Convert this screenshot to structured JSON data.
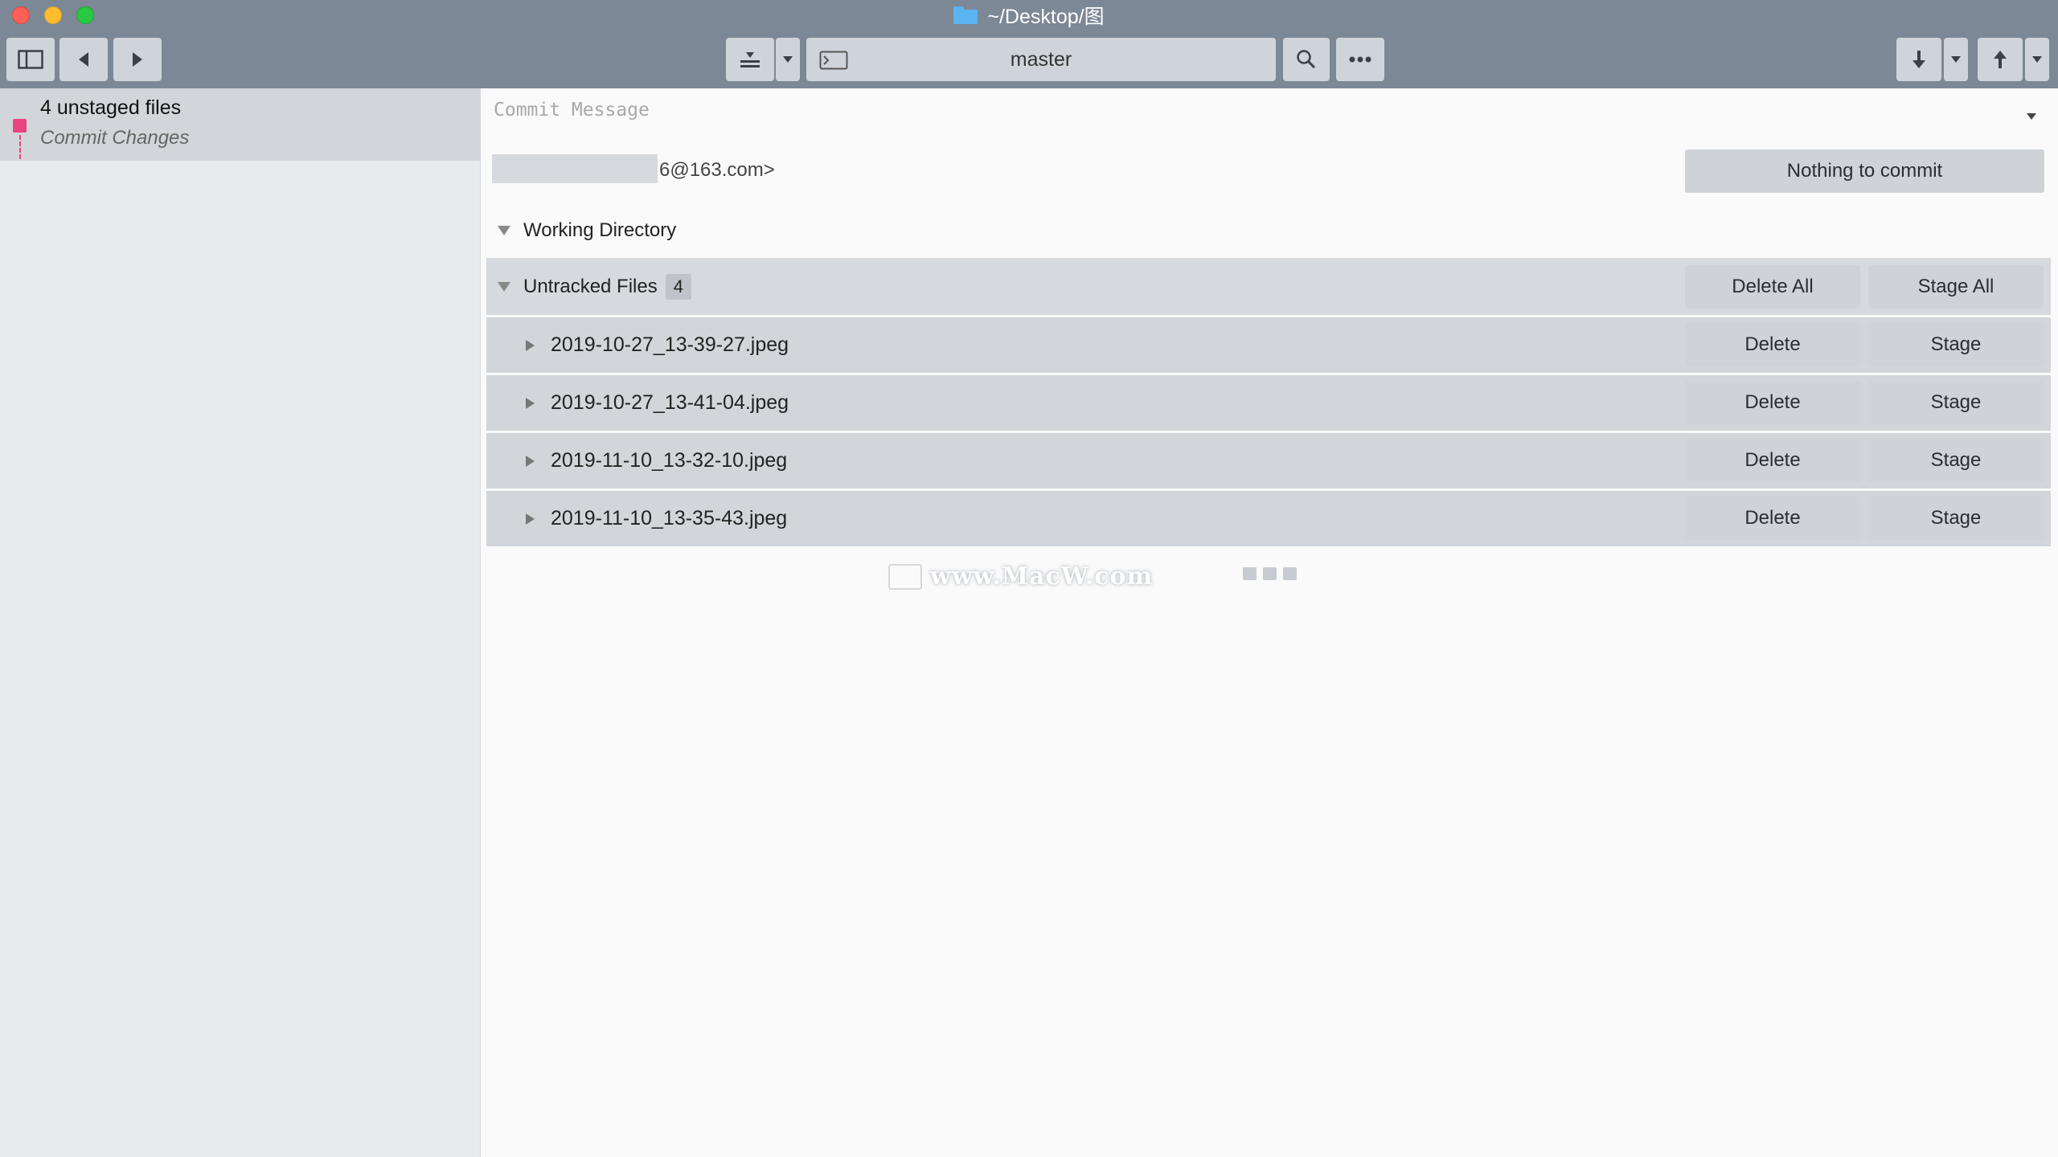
{
  "window": {
    "title": "~/Desktop/图",
    "close_color": "#fe5f57",
    "minimize_color": "#febc2e",
    "zoom_color": "#28c840"
  },
  "toolbar": {
    "sidebar_toggle_icon": "sidebar-icon",
    "back_icon": "back-icon",
    "forward_icon": "forward-icon",
    "stash_icon": "stash-icon",
    "branch": "master",
    "search_icon": "search-icon",
    "more_icon": "more-icon",
    "pull_icon": "pull-icon",
    "push_icon": "push-icon"
  },
  "sidebar": {
    "items": [
      {
        "title": "4 unstaged files",
        "subtitle": "Commit Changes",
        "marker_color": "#e8457e"
      }
    ]
  },
  "commit": {
    "message_placeholder": "Commit Message",
    "author_email_suffix": "6@163.com>",
    "commit_button": "Nothing to commit"
  },
  "working_directory": {
    "label": "Working Directory",
    "untracked": {
      "label": "Untracked Files",
      "count": "4",
      "delete_all": "Delete All",
      "stage_all": "Stage All",
      "files": [
        {
          "name": "2019-10-27_13-39-27.jpeg",
          "delete": "Delete",
          "stage": "Stage"
        },
        {
          "name": "2019-10-27_13-41-04.jpeg",
          "delete": "Delete",
          "stage": "Stage"
        },
        {
          "name": "2019-11-10_13-32-10.jpeg",
          "delete": "Delete",
          "stage": "Stage"
        },
        {
          "name": "2019-11-10_13-35-43.jpeg",
          "delete": "Delete",
          "stage": "Stage"
        }
      ]
    }
  },
  "watermark": {
    "text": "www.MacW.com"
  }
}
